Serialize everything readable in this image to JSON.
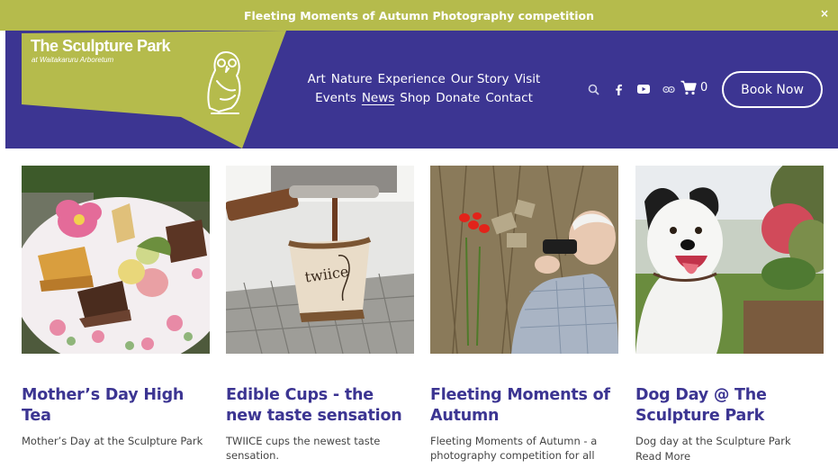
{
  "announcement": {
    "text": "Fleeting Moments of Autumn Photography competition",
    "close_label": "×"
  },
  "logo": {
    "title": "The Sculpture Park",
    "subtitle": "at Waitakaruru Arboretum"
  },
  "nav": {
    "row1": [
      "Art",
      "Nature",
      "Experience",
      "Our Story",
      "Visit"
    ],
    "row2": [
      "Events",
      "News",
      "Shop",
      "Donate",
      "Contact"
    ],
    "active": "News"
  },
  "header_icons": [
    "search-icon",
    "facebook-icon",
    "youtube-icon",
    "tripadvisor-icon"
  ],
  "cart": {
    "count": "0"
  },
  "book_button": "Book Now",
  "colors": {
    "brand_purple": "#3c3592",
    "brand_olive": "#b5bb4c"
  },
  "posts": [
    {
      "title": "Mother’s Day High Tea",
      "excerpt": "Mother’s Day at the Sculpture Park",
      "more": ""
    },
    {
      "title": "Edible Cups - the new taste sensation",
      "excerpt": "TWIICE cups the newest taste sensation.",
      "more": ""
    },
    {
      "title": "Fleeting Moments of Autumn",
      "excerpt": "Fleeting Moments of Autumn - a photography competition for all",
      "more": ""
    },
    {
      "title": "Dog Day @ The Sculpture Park",
      "excerpt": "Dog day at the Sculpture Park",
      "more": "Read More"
    }
  ]
}
